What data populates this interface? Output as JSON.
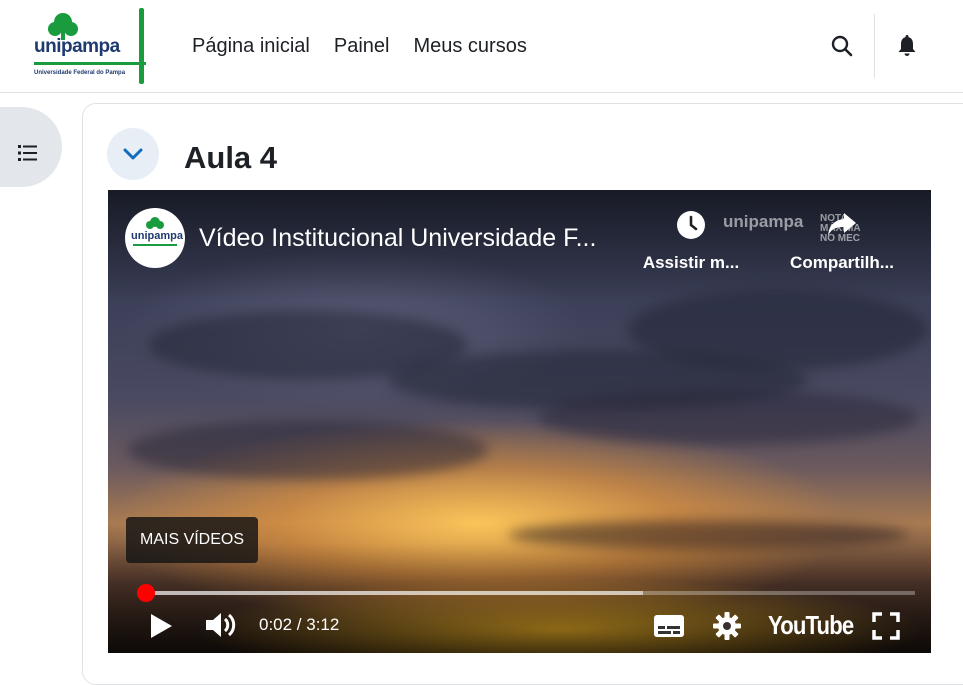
{
  "navbar": {
    "logo_text": "unipampa",
    "logo_subtext": "Universidade Federal do Pampa",
    "links": [
      "Página inicial",
      "Painel",
      "Meus cursos"
    ]
  },
  "section": {
    "title": "Aula 4"
  },
  "video": {
    "channel_logo_text": "unipampa",
    "title": "Vídeo Institucional Universidade F...",
    "watch_later_label": "Assistir m...",
    "share_label": "Compartilh...",
    "watermark_logo": "unipampa",
    "watermark_badge": [
      "NOTA",
      "MÁXIMA",
      "NO MEC"
    ],
    "more_videos_label": "MAIS VÍDEOS",
    "time": "0:02 / 3:12",
    "progress_played_fraction": 0.011,
    "progress_buffered_fraction": 0.65,
    "player_brand": "YouTube"
  },
  "colors": {
    "brand_green": "#1a9c3e",
    "brand_blue": "#1e3a6e",
    "progress_red": "#ff0000",
    "collapse_chevron": "#0f6cbf"
  }
}
